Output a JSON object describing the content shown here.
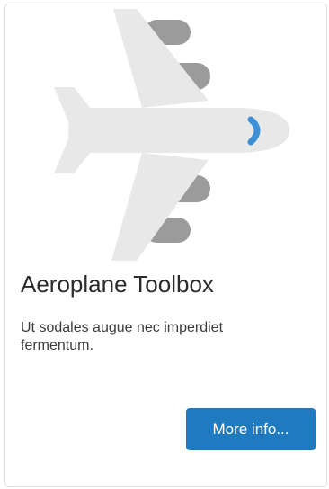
{
  "card": {
    "icon": "aeroplane-icon",
    "title": "Aeroplane Toolbox",
    "description": "Ut sodales augue nec imperdiet fermentum.",
    "button_label": "More info..."
  },
  "colors": {
    "plane_body": "#e8e8e8",
    "engines": "#9b9b9b",
    "cockpit_window": "#3d8fd6",
    "button_bg": "#1f7ac0",
    "button_text": "#ffffff"
  }
}
